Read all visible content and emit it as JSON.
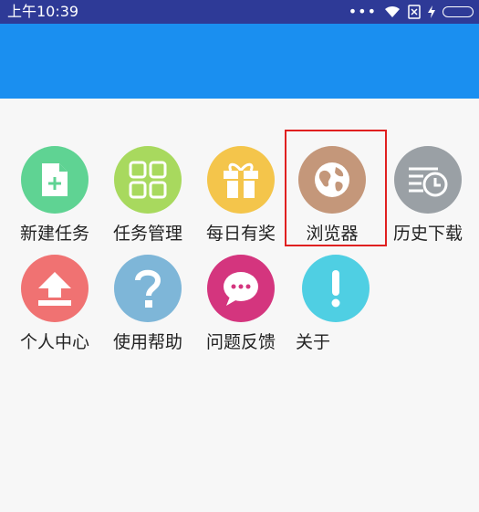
{
  "status_bar": {
    "time": "上午10:39",
    "dots": "•••"
  },
  "colors": {
    "status_bar": "#2e3a97",
    "app_bar": "#1a8ff0",
    "new_task": "#5fd393",
    "task_manage": "#a8d95e",
    "daily_reward": "#f4c54b",
    "browser": "#c4977a",
    "history": "#9aa0a5",
    "personal": "#f07272",
    "help": "#7eb6d8",
    "feedback": "#d4357e",
    "about": "#4fcfe3",
    "highlight": "#e02020"
  },
  "menu": [
    {
      "label": "新建任务",
      "icon": "new-file-icon"
    },
    {
      "label": "任务管理",
      "icon": "grid-icon"
    },
    {
      "label": "每日有奖",
      "icon": "gift-icon"
    },
    {
      "label": "浏览器",
      "icon": "globe-icon"
    },
    {
      "label": "历史下载",
      "icon": "history-clock-icon"
    },
    {
      "label": "个人中心",
      "icon": "upload-icon"
    },
    {
      "label": "使用帮助",
      "icon": "question-icon"
    },
    {
      "label": "问题反馈",
      "icon": "chat-bubble-icon"
    },
    {
      "label": "关于",
      "icon": "exclamation-icon"
    }
  ]
}
